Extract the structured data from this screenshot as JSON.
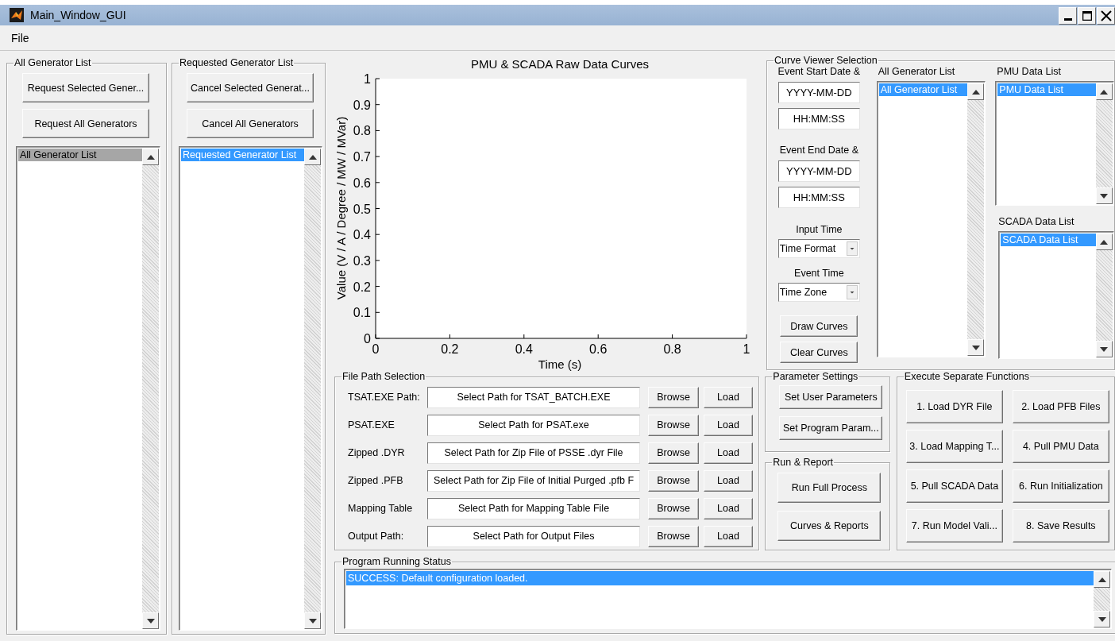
{
  "window": {
    "title": "Main_Window_GUI"
  },
  "menu": [
    {
      "label": "File"
    }
  ],
  "all_generators": {
    "title": "All Generator List",
    "buttons": [
      "Request Selected Gener...",
      "Request All Generators"
    ],
    "list": {
      "focused": false,
      "items": [
        {
          "label": "All Generator List",
          "selected": true
        }
      ]
    }
  },
  "requested_generators": {
    "title": "Requested Generator List",
    "buttons": [
      "Cancel Selected Generat...",
      "Cancel All Generators"
    ],
    "list": {
      "focused": true,
      "items": [
        {
          "label": "Requested Generator List",
          "selected": true
        }
      ]
    }
  },
  "plot": {
    "chart_data": {
      "type": "line",
      "title": "PMU & SCADA Raw Data Curves",
      "xlabel": "Time (s)",
      "ylabel": "Value (V / A / Degree / MW / MVar)",
      "xlim": [
        0,
        1
      ],
      "ylim": [
        0,
        1
      ],
      "xticks": [
        0,
        0.2,
        0.4,
        0.6,
        0.8,
        1
      ],
      "yticks": [
        0,
        0.1,
        0.2,
        0.3,
        0.4,
        0.5,
        0.6,
        0.7,
        0.8,
        0.9,
        1
      ]
    }
  },
  "curve_viewer": {
    "title": "Curve Viewer Selection",
    "start_label": "Event Start Date &",
    "start_date": "YYYY-MM-DD",
    "start_time": "HH:MM:SS",
    "end_label": "Event End Date &",
    "end_date": "YYYY-MM-DD",
    "end_time": "HH:MM:SS",
    "input_time_label": "Input Time",
    "input_time_value": "Time Format",
    "event_time_label": "Event Time",
    "event_time_value": "Time Zone",
    "buttons": [
      "Draw Curves",
      "Clear Curves"
    ],
    "lists": [
      {
        "title": "All Generator List",
        "focused": true,
        "items": [
          {
            "label": "All Generator List",
            "selected": true
          }
        ]
      },
      {
        "title": "PMU Data List",
        "focused": true,
        "items": [
          {
            "label": "PMU Data List",
            "selected": true
          }
        ]
      },
      {
        "title": "SCADA Data List",
        "focused": true,
        "items": [
          {
            "label": "SCADA Data List",
            "selected": true
          }
        ]
      }
    ]
  },
  "file_paths": {
    "title": "File Path Selection",
    "rows": [
      {
        "label": "TSAT.EXE Path:",
        "path": "Select Path for TSAT_BATCH.EXE",
        "buttons": [
          "Browse",
          "Load"
        ]
      },
      {
        "label": "PSAT.EXE",
        "path": "Select Path for PSAT.exe",
        "buttons": [
          "Browse",
          "Load"
        ]
      },
      {
        "label": "Zipped .DYR",
        "path": "Select Path for Zip File of PSSE .dyr File",
        "buttons": [
          "Browse",
          "Load"
        ]
      },
      {
        "label": "Zipped .PFB",
        "path": "Select Path for Zip File of Initial Purged .pfb F",
        "buttons": [
          "Browse",
          "Load"
        ]
      },
      {
        "label": "Mapping Table",
        "path": "Select Path for Mapping Table File",
        "buttons": [
          "Browse",
          "Load"
        ]
      },
      {
        "label": "Output Path:",
        "path": "Select Path for Output Files",
        "buttons": [
          "Browse",
          "Load"
        ]
      }
    ]
  },
  "parameter_settings": {
    "title": "Parameter Settings",
    "buttons": [
      "Set User Parameters",
      "Set Program Param..."
    ]
  },
  "run_report": {
    "title": "Run & Report",
    "buttons": [
      "Run Full Process",
      "Curves & Reports"
    ]
  },
  "execute": {
    "title": "Execute Separate Functions",
    "buttons": [
      "1. Load DYR File",
      "2. Load PFB Files",
      "3. Load Mapping T...",
      "4. Pull PMU Data",
      "5. Pull SCADA Data",
      "6. Run Initialization",
      "7. Run Model Vali...",
      "8. Save Results"
    ]
  },
  "status": {
    "title": "Program Running Status",
    "list": {
      "focused": true,
      "items": [
        {
          "label": "SUCCESS: Default configuration loaded.",
          "selected": true
        }
      ]
    }
  }
}
